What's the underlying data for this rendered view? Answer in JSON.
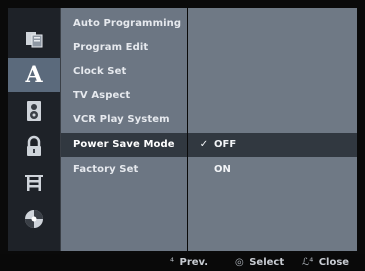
{
  "sidebar": {
    "icons": [
      {
        "name": "disc-icon",
        "selected": false
      },
      {
        "name": "language-icon",
        "glyph": "A",
        "selected": true
      },
      {
        "name": "audio-icon",
        "selected": false
      },
      {
        "name": "lock-icon",
        "selected": false
      },
      {
        "name": "record-icon",
        "selected": false
      },
      {
        "name": "others-icon",
        "selected": false
      }
    ]
  },
  "menu": {
    "items": [
      {
        "label": "Auto Programming"
      },
      {
        "label": "Program Edit"
      },
      {
        "label": "Clock Set"
      },
      {
        "label": "TV Aspect"
      },
      {
        "label": "VCR Play System"
      },
      {
        "label": "Power Save Mode",
        "selected": true
      },
      {
        "label": "Factory Set"
      }
    ]
  },
  "options": {
    "items": [
      {
        "label": "OFF",
        "checked": true,
        "check_glyph": "✓"
      },
      {
        "label": "ON",
        "checked": false
      }
    ]
  },
  "footer": {
    "prev_glyph": "⁴",
    "prev_label": "Prev.",
    "select_glyph": "◎",
    "select_label": "Select",
    "close_glyph": "ℒ⁴",
    "close_label": "Close"
  },
  "colors": {
    "menu_bg": "#6c7683",
    "options_bg": "#6f7985",
    "selected_bg": "#313840",
    "icon_bg": "#1e2228",
    "screen_bg": "#0a0a0a"
  }
}
